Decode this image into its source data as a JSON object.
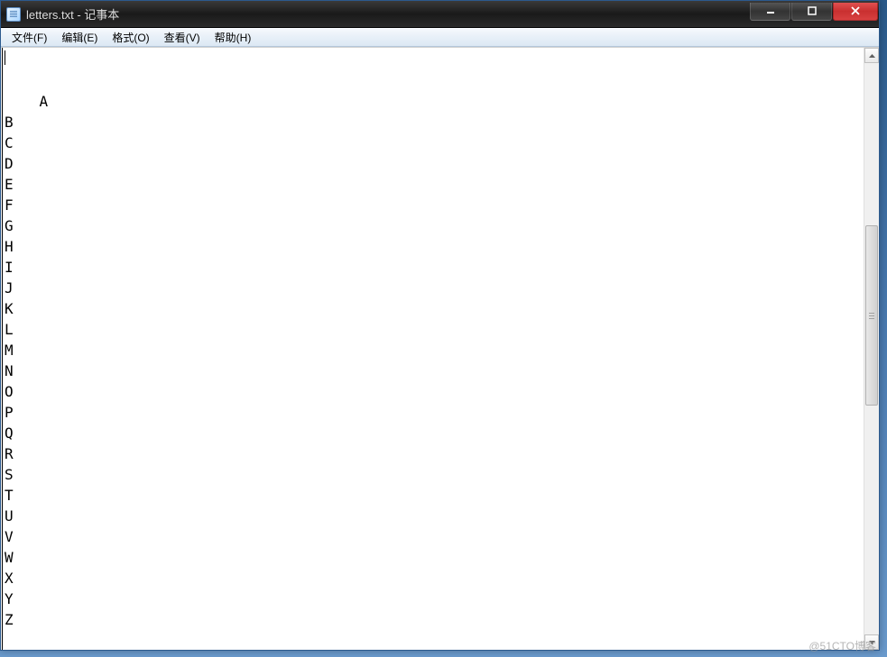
{
  "window": {
    "title": "letters.txt - 记事本"
  },
  "menu": {
    "file": "文件(F)",
    "edit": "编辑(E)",
    "format": "格式(O)",
    "view": "查看(V)",
    "help": "帮助(H)"
  },
  "content": {
    "lines": [
      "A",
      "B",
      "C",
      "D",
      "E",
      "F",
      "G",
      "H",
      "I",
      "J",
      "K",
      "L",
      "M",
      "N",
      "O",
      "P",
      "Q",
      "R",
      "S",
      "T",
      "U",
      "V",
      "W",
      "X",
      "Y",
      "Z"
    ]
  },
  "watermark": "@51CTO博客"
}
